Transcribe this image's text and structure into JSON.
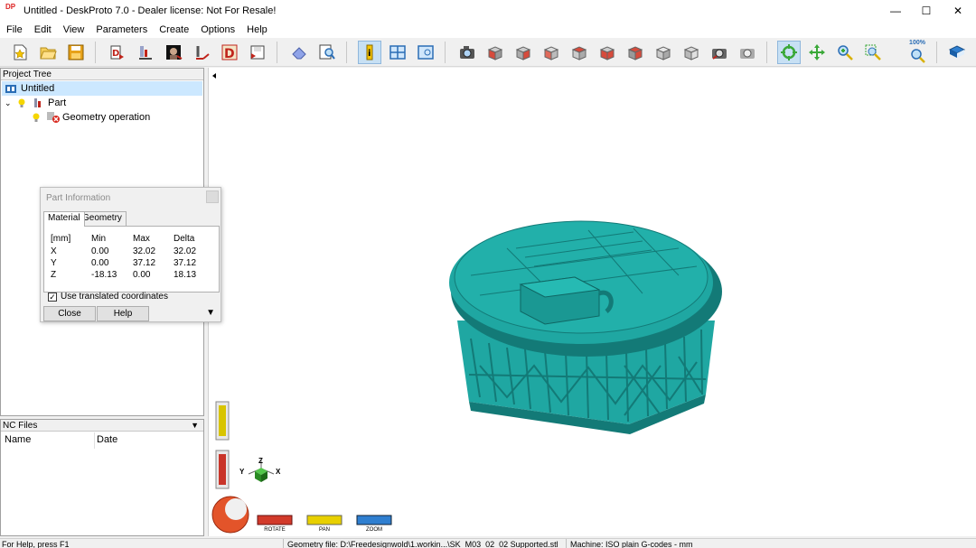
{
  "window": {
    "title": "Untitled - DeskProto 7.0 - Dealer license: Not For Resale!",
    "logo_text": "DP",
    "minimize_label": "—",
    "maximize_label": "☐",
    "close_label": "✕"
  },
  "menu": [
    "File",
    "Edit",
    "View",
    "Parameters",
    "Create",
    "Options",
    "Help"
  ],
  "toolbar": {
    "zoom_label": "100%",
    "buttons": [
      "new-project",
      "open-project",
      "save-project",
      "import-geometry",
      "geometry-wizard",
      "bitmap-wizard",
      "vector-wizard",
      "drawing-wizard",
      "export",
      "part-info",
      "show-info",
      "layout-view",
      "show-toolpath",
      "snapshot",
      "view-front",
      "view-back",
      "view-left",
      "view-right",
      "view-top",
      "view-bottom",
      "view-iso1",
      "view-iso2",
      "view-home",
      "rotate-view",
      "pan-view",
      "zoom-in",
      "zoom-window",
      "zoom-fit",
      "manual"
    ]
  },
  "project_tree": {
    "header": "Project Tree",
    "items": [
      {
        "label": "Untitled",
        "level": 0
      },
      {
        "label": "Part",
        "level": 1
      },
      {
        "label": "Geometry operation",
        "level": 2
      }
    ]
  },
  "nc_files": {
    "header": "NC Files",
    "columns": [
      "Name",
      "Date"
    ]
  },
  "part_info": {
    "title": "Part Information",
    "tabs": [
      "Material",
      "Geometry"
    ],
    "active_tab": "Material",
    "headers": [
      "[mm]",
      "Min",
      "Max",
      "Delta"
    ],
    "rows": [
      {
        "axis": "X",
        "min": "0.00",
        "max": "32.02",
        "delta": "32.02"
      },
      {
        "axis": "Y",
        "min": "0.00",
        "max": "37.12",
        "delta": "37.12"
      },
      {
        "axis": "Z",
        "min": "-18.13",
        "max": "0.00",
        "delta": "18.13"
      }
    ],
    "checkbox_label": "Use translated coordinates",
    "checkbox_checked": true,
    "close_label": "Close",
    "help_label": "Help"
  },
  "viewport": {
    "rotate_label": "ROTATE",
    "pan_label": "PAN",
    "zoom_label": "ZOOM",
    "axis_x": "X",
    "axis_y": "Y",
    "axis_z": "Z",
    "model_color": "#1fa7a2",
    "model_shadow": "#137a77"
  },
  "status": {
    "help": "For Help, press F1",
    "geometry_file": "Geometry file: D:\\Freedesignwold\\1.workin...\\SK_M03_02_02 Supported.stl",
    "machine": "Machine: ISO plain G-codes - mm"
  }
}
